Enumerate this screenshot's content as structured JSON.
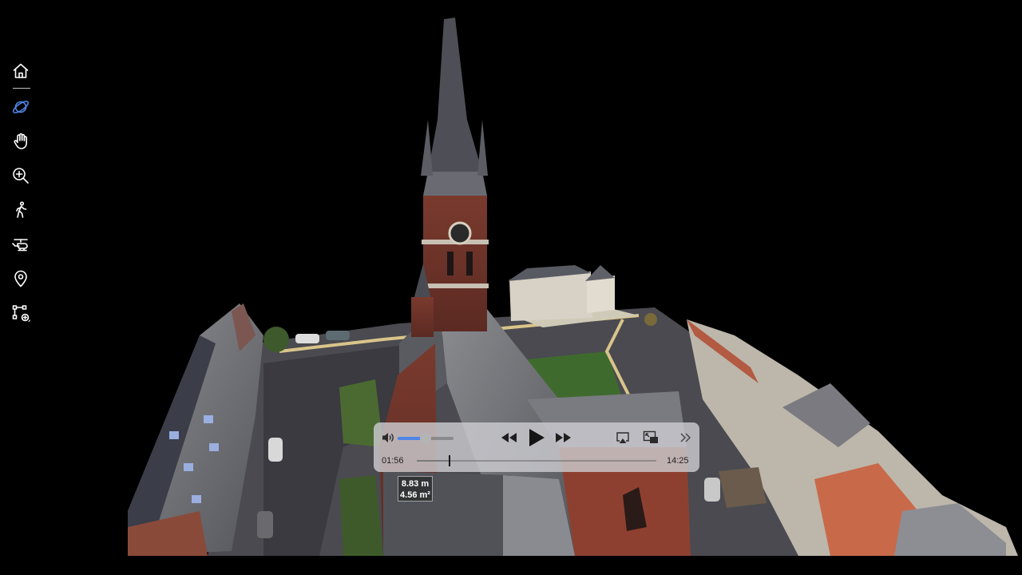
{
  "colors": {
    "accent": "#4f86e6",
    "background": "#000000"
  },
  "toolbar": {
    "tools": [
      {
        "icon": "home-icon",
        "label": "Home",
        "active": false
      },
      {
        "icon": "orbit-icon",
        "label": "Orbit",
        "active": true
      },
      {
        "icon": "pan-hand-icon",
        "label": "Pan",
        "active": false
      },
      {
        "icon": "zoom-in-icon",
        "label": "Zoom",
        "active": false
      },
      {
        "icon": "walk-icon",
        "label": "Walk",
        "active": false
      },
      {
        "icon": "helicopter-icon",
        "label": "Fly",
        "active": false
      },
      {
        "icon": "location-pin-icon",
        "label": "Locations",
        "active": false
      },
      {
        "icon": "add-measurement-icon",
        "label": "Measure",
        "active": false
      }
    ]
  },
  "measurement": {
    "distance": "8.83 m",
    "area": "4.56 m²"
  },
  "player": {
    "volume_fraction": 0.5,
    "elapsed": "01:56",
    "total": "14:25",
    "progress_fraction": 0.136,
    "icons": [
      "volume-icon",
      "rewind-icon",
      "play-icon",
      "fast-forward-icon",
      "airplay-icon",
      "picture-in-picture-icon",
      "more-chevron-icon"
    ]
  }
}
